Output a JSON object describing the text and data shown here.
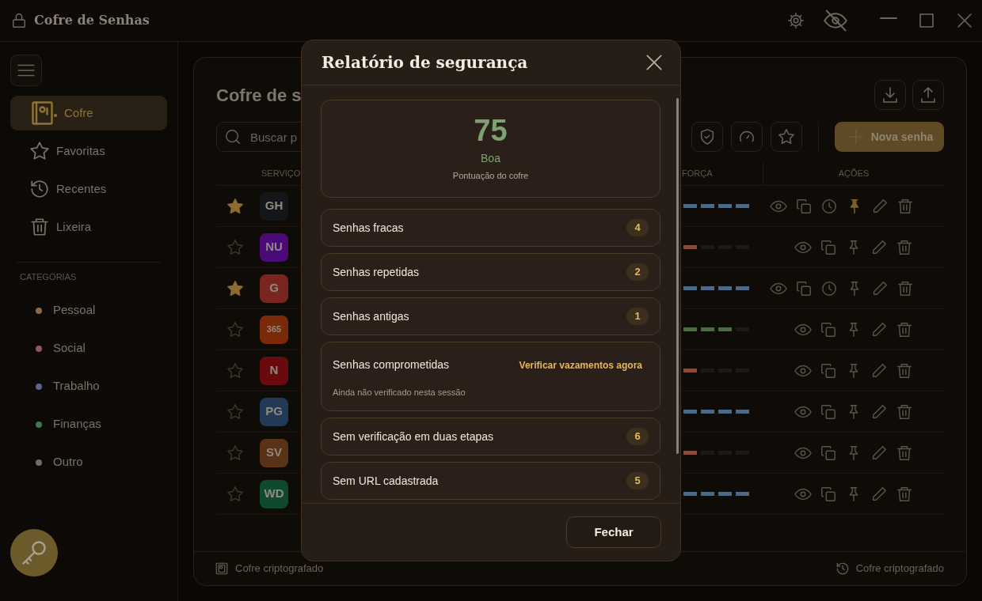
{
  "window": {
    "title": "Cofre de Senhas"
  },
  "sidebar": {
    "items": [
      {
        "label": "Cofre",
        "kind": "vault",
        "selected": true
      },
      {
        "label": "Favoritas",
        "kind": "star",
        "selected": false
      },
      {
        "label": "Recentes",
        "kind": "history",
        "selected": false
      },
      {
        "label": "Lixeira",
        "kind": "trash",
        "selected": false
      }
    ],
    "categories_heading": "CATEGORIAS",
    "categories": [
      {
        "label": "Pessoal",
        "color": "#8a6a4a"
      },
      {
        "label": "Social",
        "color": "#8a5565"
      },
      {
        "label": "Trabalho",
        "color": "#5a628e"
      },
      {
        "label": "Finanças",
        "color": "#3a7a4e"
      },
      {
        "label": "Outro",
        "color": "#6e6a70"
      }
    ]
  },
  "vault": {
    "title": "Cofre de s",
    "search": {
      "placeholder": "Buscar p"
    },
    "new_button": "Nova senha",
    "table": {
      "columns": [
        "SERVIÇO",
        "FORÇA",
        "AÇÕES"
      ],
      "rows": [
        {
          "favorite": true,
          "avatar": "GH",
          "color": "#15161a",
          "level": 1,
          "history": true,
          "pinned": true
        },
        {
          "favorite": false,
          "avatar": "NU",
          "color": "#4a0b78",
          "level": 0.25,
          "history": false,
          "pinned": false
        },
        {
          "favorite": true,
          "avatar": "G",
          "color": "#7a2620",
          "level": 1,
          "history": true,
          "pinned": false
        },
        {
          "favorite": false,
          "avatar": "365",
          "color": "#7a2a08",
          "level": 0.75,
          "history": false,
          "pinned": false
        },
        {
          "favorite": false,
          "avatar": "N",
          "color": "#6a0a0e",
          "level": 0.25,
          "history": false,
          "pinned": false
        },
        {
          "favorite": false,
          "avatar": "PG",
          "color": "#213a56",
          "level": 1,
          "history": false,
          "pinned": false
        },
        {
          "favorite": false,
          "avatar": "SV",
          "color": "#5a3216",
          "level": 0.25,
          "history": false,
          "pinned": false
        },
        {
          "favorite": false,
          "avatar": "WD",
          "color": "#0f4a2c",
          "level": 1,
          "history": false,
          "pinned": false
        }
      ]
    },
    "footer": {
      "left": "Cofre criptografado",
      "right": "Cofre criptografado"
    }
  },
  "dialog": {
    "title": "Relatório de segurança",
    "score": "75",
    "rating": "Boa",
    "score_caption": "Pontuação do cofre",
    "items": [
      {
        "kind": "count",
        "label": "Senhas fracas",
        "count": "4"
      },
      {
        "kind": "count",
        "label": "Senhas repetidas",
        "count": "2"
      },
      {
        "kind": "count",
        "label": "Senhas antigas",
        "count": "1"
      },
      {
        "kind": "action",
        "label": "Senhas comprometidas",
        "action": "Verificar vazamentos agora",
        "note": "Ainda não verificado nesta sessão"
      },
      {
        "kind": "count",
        "label": "Sem verificação em duas etapas",
        "count": "6"
      },
      {
        "kind": "count",
        "label": "Sem URL cadastrada",
        "count": "5"
      }
    ],
    "close_button": "Fechar"
  }
}
